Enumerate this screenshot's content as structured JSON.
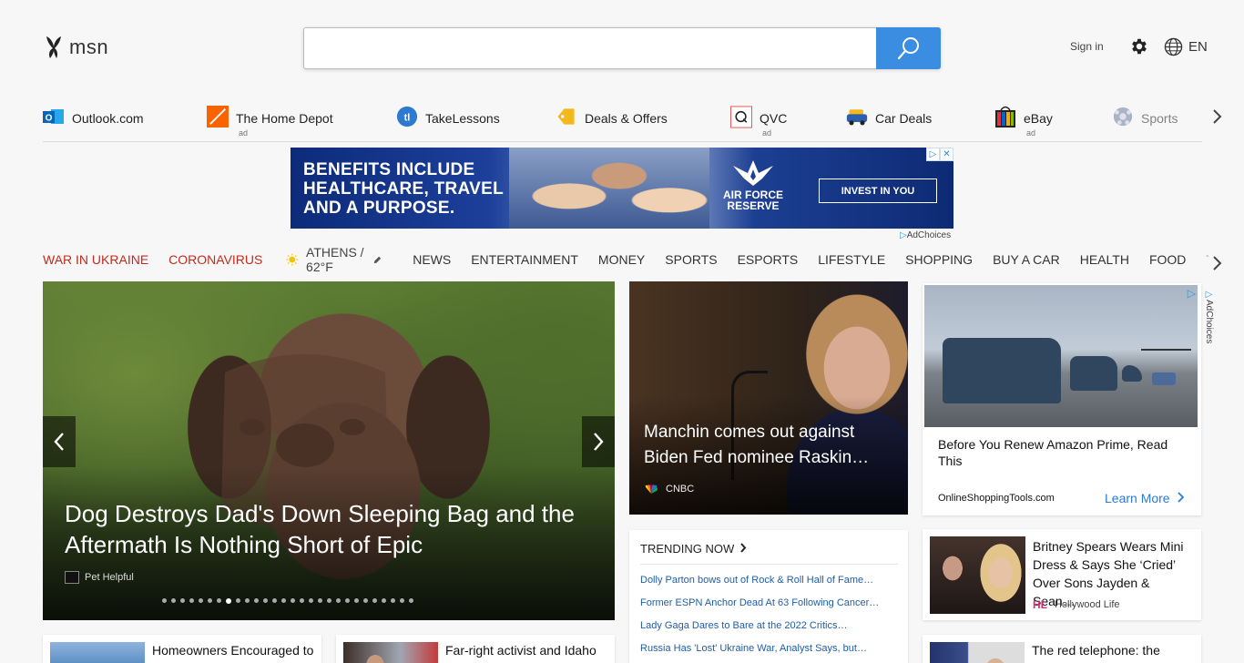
{
  "header": {
    "logo_text": "msn",
    "search_placeholder": "",
    "signin_label": "Sign in",
    "language": "EN"
  },
  "quick_links": [
    {
      "label": "Outlook.com",
      "icon": "outlook-icon",
      "ad": ""
    },
    {
      "label": "The Home Depot",
      "icon": "home-depot-icon",
      "ad": "ad"
    },
    {
      "label": "TakeLessons",
      "icon": "takelessons-icon",
      "ad": ""
    },
    {
      "label": "Deals & Offers",
      "icon": "deals-tag-icon",
      "ad": ""
    },
    {
      "label": "QVC",
      "icon": "qvc-icon",
      "ad": "ad"
    },
    {
      "label": "Car Deals",
      "icon": "car-icon",
      "ad": ""
    },
    {
      "label": "eBay",
      "icon": "ebay-bag-icon",
      "ad": "ad"
    },
    {
      "label": "Sports",
      "icon": "sports-ball-icon",
      "ad": ""
    }
  ],
  "banner_ad": {
    "line1": "BENEFITS INCLUDE",
    "line2": "HEALTHCARE, TRAVEL",
    "line3": "AND A PURPOSE.",
    "brand_line1": "AIR FORCE",
    "brand_line2": "RESERVE",
    "cta": "INVEST IN YOU",
    "adchoices": "AdChoices"
  },
  "nav": {
    "war": "WAR IN UKRAINE",
    "corona": "CORONAVIRUS",
    "weather": "ATHENS / 62°F",
    "items": [
      "NEWS",
      "ENTERTAINMENT",
      "MONEY",
      "SPORTS",
      "ESPORTS",
      "LIFESTYLE",
      "SHOPPING",
      "BUY A CAR",
      "HEALTH",
      "FOOD"
    ],
    "faded": "TRAVEL"
  },
  "hero": {
    "title": "Dog Destroys Dad's Down Sleeping Bag and the Aftermath Is Nothing Short of Epic",
    "source": "Pet Helpful",
    "dot_count": 28,
    "active_dot": 7
  },
  "mid_story": {
    "title": "Manchin comes out against Biden Fed nominee Raskin…",
    "source": "CNBC"
  },
  "right_ad": {
    "title": "Before You Renew Amazon Prime, Read This",
    "domain": "OnlineShoppingTools.com",
    "cta": "Learn More",
    "adchoices": "AdChoices"
  },
  "trending": {
    "heading": "TRENDING NOW",
    "items": [
      "Dolly Parton bows out of Rock & Roll Hall of Fame…",
      "Former ESPN Anchor Dead At 63 Following Cancer…",
      "Lady Gaga Dares to Bare at the 2022 Critics…",
      "Russia Has 'Lost' Ukraine War, Analyst Says, but…"
    ]
  },
  "britney": {
    "title": "Britney Spears Wears Mini Dress & Says She ‘Cried’ Over Sons Jayden & Sean…",
    "source_logo": "HL",
    "source": "Hollywood Life"
  },
  "bottom_cards": [
    {
      "title": "Homeowners Encouraged to"
    },
    {
      "title": "Far-right activist and Idaho"
    },
    {
      "title": "The red telephone: the"
    }
  ]
}
